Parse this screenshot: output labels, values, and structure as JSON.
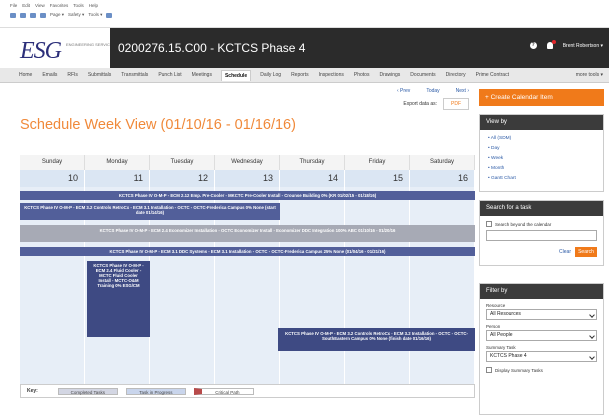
{
  "browser": {
    "menu": [
      "File",
      "Edit",
      "View",
      "Favorites",
      "Tools",
      "Help"
    ],
    "toolbar": [
      "Page ▾",
      "Safety ▾",
      "Tools ▾"
    ]
  },
  "header": {
    "logo": "ESG",
    "logo_sub": "ENGINEERING SERVICES GROUP",
    "project_title": "0200276.15.C00 - KCTCS Phase 4",
    "user": "Brent Robertson ▾"
  },
  "nav": {
    "tabs": [
      "Home",
      "Emails",
      "RFIs",
      "Submittals",
      "Transmittals",
      "Punch List",
      "Meetings",
      "Schedule",
      "Daily Log",
      "Reports",
      "Inspections",
      "Photos",
      "Drawings",
      "Documents",
      "Directory",
      "Prime Contract"
    ],
    "active": "Schedule",
    "more": "more tools ▾"
  },
  "pager": {
    "prev": "‹ Prev",
    "today": "Today",
    "next": "Next ›"
  },
  "export": {
    "label": "Export data as:",
    "button": "PDF"
  },
  "week_title": "Schedule Week View (01/10/16 - 01/16/16)",
  "calendar": {
    "days": [
      "Sunday",
      "Monday",
      "Tuesday",
      "Wednesday",
      "Thursday",
      "Friday",
      "Saturday"
    ],
    "dates": [
      "10",
      "11",
      "12",
      "13",
      "14",
      "15",
      "16"
    ]
  },
  "tasks": [
    "KCTCS Phase IV O-M-P - ECM 2.12 Emp. Pre-Cooler - MKCTC Pre-Cooler Install - Crounse Building 0% (KR 01/02/15 - 01/18/16)",
    "KCTCS Phase IV O-M-P - ECM 3.2 Controls RetroCx - ECM 3.1 Installation - OCTC - OCTC-Frederica Campus 0% None (start date 01/14/16)",
    "KCTCS Phase IV O-M-P - ECM 2.4 Economizer Installation - OCTC Economizer Install - Economizer DDC Integration 100% ABC 01/10/16 - 01/20/16",
    "KCTCS Phase IV O-M-P - ECM 3.1 DDC Systems - ECM 3.1 Installation - OCTC - OCTC-Frederica Campus 25% None (01/04/16 - 01/21/16)",
    "KCTCS Phase IV O-M-P - ECM 2.4 Fluid Cooler - MCTC Fluid Cooler Install - MCTC-O&M Training 0% ESG/CM",
    "KCTCS Phase IV O-M-P - ECM 3.2 Controls RetroCx - ECM 3.2 Installation - OCTC - OCTC-SouthEastern Campus 0% None (finish date 01/16/16)"
  ],
  "key": {
    "label": "Key:",
    "completed": "Completed Tasks",
    "in_progress": "Task in Progress",
    "critical": "Critical Path"
  },
  "sidebar": {
    "create_button": "+ Create Calendar Item",
    "view_by": {
      "title": "View by",
      "items": [
        "All (SDM)",
        "Day",
        "Week",
        "Month",
        "Gantt Chart"
      ]
    },
    "search": {
      "title": "Search for a task",
      "checkbox": "Search beyond the calendar",
      "clear": "Clear",
      "button": "Search"
    },
    "filter": {
      "title": "Filter by",
      "resource_label": "Resource",
      "resource_value": "All Resources",
      "person_label": "Person",
      "person_value": "All People",
      "summary_label": "Summary Task",
      "summary_value": "KCTCS Phase 4",
      "display_summary": "Display Summary Tasks"
    }
  },
  "colors": {
    "accent": "#f07a1a",
    "task_blue": "#525f9a",
    "task_grey": "#a7aab5",
    "dark_bar": "#2b2b2b"
  }
}
